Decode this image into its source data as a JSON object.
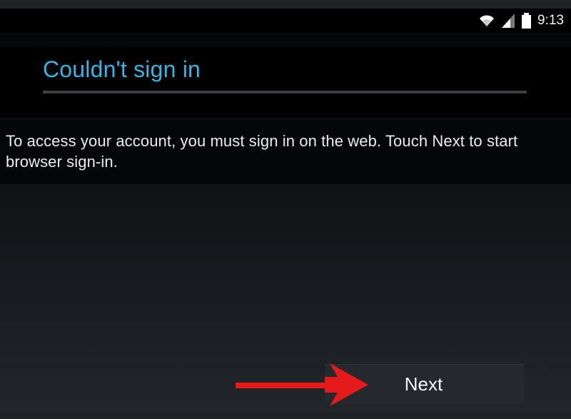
{
  "status_bar": {
    "time": "9:13",
    "icons": [
      "wifi-icon",
      "signal-icon",
      "battery-icon"
    ]
  },
  "dialog": {
    "title": "Couldn't sign in",
    "message": "To access your account, you must sign in on the web. Touch Next to start browser sign-in.",
    "next_label": "Next"
  },
  "colors": {
    "title_accent": "#33b5e5",
    "arrow": "#e51b1b",
    "button_bg": "#25292d"
  }
}
